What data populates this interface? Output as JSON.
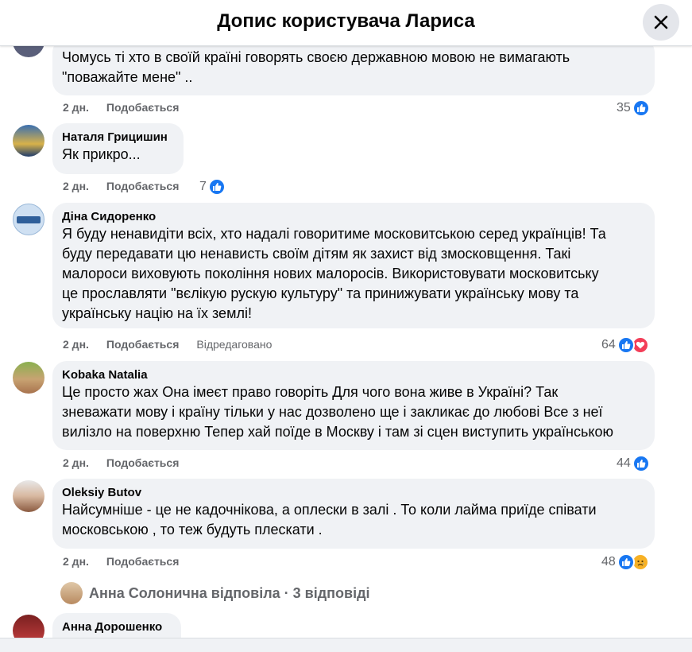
{
  "header": {
    "title": "Допис користувача Лариса"
  },
  "colors": {
    "accent": "#1877f2",
    "love": "#f33e58",
    "sad": "#f7b125",
    "muted": "#65676b"
  },
  "comments": [
    {
      "author": "",
      "lines": [
        "Чомусь ті хто в своїй країні говорять своєю державною мовою не вимагають",
        "\"поважайте мене\" .."
      ],
      "time": "2 дн.",
      "like_label": "Подобається",
      "edited": "",
      "reaction_count": "35",
      "reactions": [
        "like-icon"
      ]
    },
    {
      "author": "Наталя Грицишин",
      "lines": [
        "Як прикро..."
      ],
      "time": "2 дн.",
      "like_label": "Подобається",
      "edited": "",
      "reaction_count": "7",
      "reactions": [
        "like-icon"
      ]
    },
    {
      "author": "Діна Сидоренко",
      "lines": [
        "Я буду ненавидіти всіх, хто надалі говоритиме московитською серед українців! Та",
        "буду передавати цю ненависть своїм дітям як захист від змосковщення. Такі",
        "малороси виховують покоління нових малоросів. Використовувати московитську",
        "це прославляти \"вєлікую рускую культуру\" та принижувати українську мову та",
        "українську націю на їх землі!"
      ],
      "time": "2 дн.",
      "like_label": "Подобається",
      "edited": "Відредаговано",
      "reaction_count": "64",
      "reactions": [
        "like-icon",
        "love-icon"
      ]
    },
    {
      "author": "Kobaka Natalia",
      "lines": [
        "Це просто жах Она імеєт право говоріть Для чого вона живе в Україні? Так",
        "зневажати мову і країну тільки у нас дозволено ще і закликає до любові Все з неї",
        "вилізло на поверхню Тепер хай поїде в Москву і там зі сцен виступить українською"
      ],
      "time": "2 дн.",
      "like_label": "Подобається",
      "edited": "",
      "reaction_count": "44",
      "reactions": [
        "like-icon"
      ]
    },
    {
      "author": "Oleksiy Butov",
      "lines": [
        "Найсумніше - це не кадочнікова, а оплески в залі . То коли лайма приїде співати",
        "московською , то теж будуть плескати ."
      ],
      "time": "2 дн.",
      "like_label": "Подобається",
      "edited": "",
      "reaction_count": "48",
      "reactions": [
        "like-icon",
        "sad-icon"
      ]
    }
  ],
  "replies_link": "Анна Солонична відповіла · 3 відповіді",
  "last_author": "Анна Дорошенко"
}
